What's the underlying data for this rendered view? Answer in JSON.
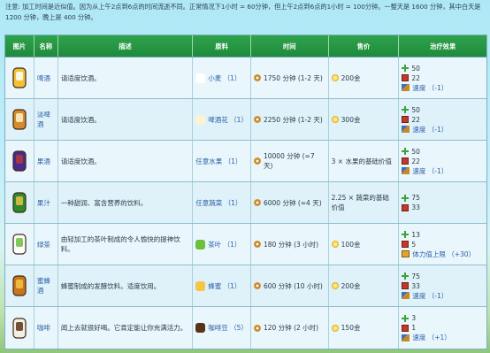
{
  "note": "注意: 加工时间是近似值。因为从上午2点到6点的时间流逝不同。正常情况下1小时 = 60分钟，但上午2点到6点的1小时 = 100分钟。一整天是 1600 分钟，其中白天是 1200 分钟，晚上是 400 分钟。",
  "headers": {
    "pic": "图片",
    "name": "名称",
    "desc": "描述",
    "ingredient": "原料",
    "time": "时间",
    "price": "售价",
    "effect": "治疗效果"
  },
  "rows": [
    {
      "name": "啤酒",
      "desc": "请适度饮酒。",
      "ingredient": "小麦 （1）",
      "ing_icon": "wheat-icon",
      "time": "1750 分钟 (1-2 天)",
      "price": "200金",
      "effects": [
        {
          "icon": "energy-icon",
          "text": "50"
        },
        {
          "icon": "health-icon",
          "text": "22"
        },
        {
          "icon": "speed-icon",
          "text": "速度 （-1）"
        }
      ],
      "colors": {
        "a": "#f2c232",
        "b": "#ffffff"
      }
    },
    {
      "name": "淡啤酒",
      "desc": "请适度饮酒。",
      "ingredient": "啤酒花 （1）",
      "ing_icon": "hops-icon",
      "time": "2250 分钟 (1-2 天)",
      "price": "300金",
      "effects": [
        {
          "icon": "energy-icon",
          "text": "50"
        },
        {
          "icon": "health-icon",
          "text": "22"
        },
        {
          "icon": "speed-icon",
          "text": "速度 （-1）"
        }
      ],
      "colors": {
        "a": "#d88a2a",
        "b": "#fff2d0"
      }
    },
    {
      "name": "果酒",
      "desc": "请适度饮酒。",
      "ingredient": "任意水果 （1）",
      "ing_icon": "",
      "time": "10000 分钟 (≈7 天)",
      "price": "3 × 水果的基础价值",
      "effects": [
        {
          "icon": "energy-icon",
          "text": "50"
        },
        {
          "icon": "health-icon",
          "text": "22"
        },
        {
          "icon": "speed-icon",
          "text": "速度 （-1）"
        }
      ],
      "colors": {
        "a": "#4a2a8a",
        "b": "#b13a3a"
      }
    },
    {
      "name": "果汁",
      "desc": "一种甜润、富含营养的饮料。",
      "ingredient": "任意蔬菜 （1）",
      "ing_icon": "",
      "time": "6000 分钟 (≈4 天)",
      "price": "2.25 × 蔬菜的基础价值",
      "effects": [
        {
          "icon": "energy-icon",
          "text": "75"
        },
        {
          "icon": "health-icon",
          "text": "33"
        }
      ],
      "colors": {
        "a": "#2f8a2a",
        "b": "#e8c24a"
      }
    },
    {
      "name": "绿茶",
      "desc": "由轻加工的茶叶制成的令人愉快的提神饮料。",
      "ingredient": "茶叶 （1）",
      "ing_icon": "tea-leaf-icon",
      "time": "180 分钟 (3 小时)",
      "price": "100金",
      "effects": [
        {
          "icon": "energy-icon",
          "text": "13"
        },
        {
          "icon": "health-icon",
          "text": "5"
        },
        {
          "icon": "stamina-icon",
          "text": "体力值上限 （+30）"
        }
      ],
      "colors": {
        "a": "#ffffff",
        "b": "#6cc03a"
      }
    },
    {
      "name": "蜜蜂酒",
      "desc": "蜂蜜制成的发酵饮料。适度饮用。",
      "ingredient": "蜂蜜 （1）",
      "ing_icon": "honey-icon",
      "time": "600 分钟 (10 小时)",
      "price": "200金",
      "effects": [
        {
          "icon": "energy-icon",
          "text": "75"
        },
        {
          "icon": "health-icon",
          "text": "33"
        },
        {
          "icon": "speed-icon",
          "text": "速度 （-1）"
        }
      ],
      "colors": {
        "a": "#c8761a",
        "b": "#f5c545"
      }
    },
    {
      "name": "咖啡",
      "desc": "闻上去就很好喝。它肯定能让你充满活力。",
      "ingredient": "咖啡豆 （5）",
      "ing_icon": "coffee-bean-icon",
      "time": "120 分钟 (2 小时)",
      "price": "150金",
      "effects": [
        {
          "icon": "energy-icon",
          "text": "3"
        },
        {
          "icon": "health-icon",
          "text": "1"
        },
        {
          "icon": "speed-icon",
          "text": "速度 （+1）"
        }
      ],
      "colors": {
        "a": "#f4efe4",
        "b": "#5a3218"
      }
    }
  ]
}
